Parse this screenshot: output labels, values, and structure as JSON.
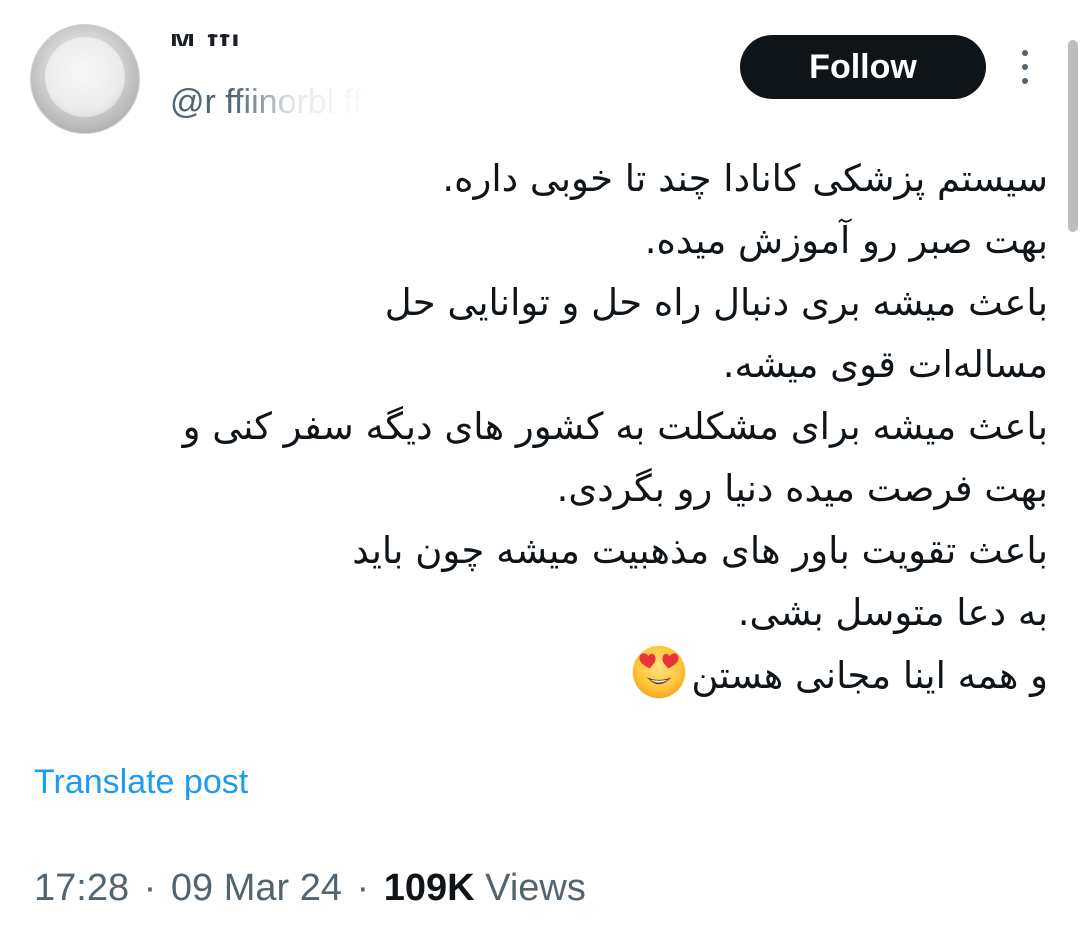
{
  "author": {
    "display_name": "M ffi",
    "handle": "@r ffiinorbl ff"
  },
  "follow_button": {
    "label": "Follow"
  },
  "more_menu": {
    "icon": "more-vertical-icon"
  },
  "tweet": {
    "lines": [
      "سیستم پزشکی کانادا چند تا خوبی داره.",
      "بهت صبر رو آموزش میده.",
      "باعث میشه بری دنبال راه حل و توانایی حل",
      "مساله‌ات قوی میشه.",
      "باعث میشه برای مشکلت به کشور های دیگه سفر کنی و",
      "بهت فرصت میده دنیا رو بگردی.",
      "باعث تقویت باور های مذهبیت میشه چون باید",
      "به دعا متوسل بشی.",
      "و همه اینا مجانی هستن"
    ],
    "emoji": "heart-eyes-emoji"
  },
  "translate": {
    "label": "Translate post"
  },
  "meta": {
    "time": "17:28",
    "date": "09 Mar 24",
    "separator": "·",
    "views_count": "109K",
    "views_label": "Views"
  },
  "colors": {
    "text": "#0f1419",
    "muted": "#536471",
    "link": "#1d9bf0",
    "button_bg": "#0f1419",
    "button_text": "#ffffff"
  }
}
